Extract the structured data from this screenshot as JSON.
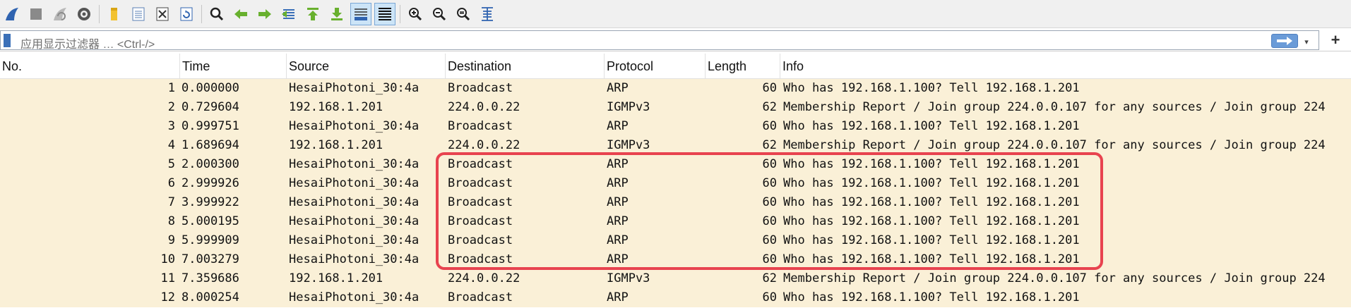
{
  "toolbar": {
    "buttons": [
      {
        "name": "start-capture-icon"
      },
      {
        "name": "stop-capture-icon"
      },
      {
        "name": "restart-capture-icon"
      },
      {
        "name": "capture-options-icon"
      },
      {
        "name": "open-file-icon"
      },
      {
        "name": "save-file-icon"
      },
      {
        "name": "close-file-icon"
      },
      {
        "name": "reload-file-icon"
      },
      {
        "name": "find-packet-icon"
      },
      {
        "name": "go-back-icon"
      },
      {
        "name": "go-forward-icon"
      },
      {
        "name": "go-to-packet-icon"
      },
      {
        "name": "go-first-icon"
      },
      {
        "name": "go-last-icon"
      },
      {
        "name": "autoscroll-icon"
      },
      {
        "name": "colorize-icon"
      },
      {
        "name": "zoom-in-icon"
      },
      {
        "name": "zoom-out-icon"
      },
      {
        "name": "zoom-normal-icon"
      },
      {
        "name": "resize-columns-icon"
      }
    ]
  },
  "filter": {
    "placeholder": "应用显示过滤器 … <Ctrl-/>",
    "plus_label": "+",
    "dropdown_glyph": "▾"
  },
  "columns": {
    "no": "No.",
    "time": "Time",
    "source": "Source",
    "destination": "Destination",
    "protocol": "Protocol",
    "length": "Length",
    "info": "Info"
  },
  "packets": [
    {
      "no": "1",
      "time": "0.000000",
      "source": "HesaiPhotoni_30:4a",
      "destination": "Broadcast",
      "protocol": "ARP",
      "length": "60",
      "info": "Who has 192.168.1.100? Tell 192.168.1.201"
    },
    {
      "no": "2",
      "time": "0.729604",
      "source": "192.168.1.201",
      "destination": "224.0.0.22",
      "protocol": "IGMPv3",
      "length": "62",
      "info": "Membership Report / Join group 224.0.0.107 for any sources / Join group 224"
    },
    {
      "no": "3",
      "time": "0.999751",
      "source": "HesaiPhotoni_30:4a",
      "destination": "Broadcast",
      "protocol": "ARP",
      "length": "60",
      "info": "Who has 192.168.1.100? Tell 192.168.1.201"
    },
    {
      "no": "4",
      "time": "1.689694",
      "source": "192.168.1.201",
      "destination": "224.0.0.22",
      "protocol": "IGMPv3",
      "length": "62",
      "info": "Membership Report / Join group 224.0.0.107 for any sources / Join group 224"
    },
    {
      "no": "5",
      "time": "2.000300",
      "source": "HesaiPhotoni_30:4a",
      "destination": "Broadcast",
      "protocol": "ARP",
      "length": "60",
      "info": "Who has 192.168.1.100? Tell 192.168.1.201"
    },
    {
      "no": "6",
      "time": "2.999926",
      "source": "HesaiPhotoni_30:4a",
      "destination": "Broadcast",
      "protocol": "ARP",
      "length": "60",
      "info": "Who has 192.168.1.100? Tell 192.168.1.201"
    },
    {
      "no": "7",
      "time": "3.999922",
      "source": "HesaiPhotoni_30:4a",
      "destination": "Broadcast",
      "protocol": "ARP",
      "length": "60",
      "info": "Who has 192.168.1.100? Tell 192.168.1.201"
    },
    {
      "no": "8",
      "time": "5.000195",
      "source": "HesaiPhotoni_30:4a",
      "destination": "Broadcast",
      "protocol": "ARP",
      "length": "60",
      "info": "Who has 192.168.1.100? Tell 192.168.1.201"
    },
    {
      "no": "9",
      "time": "5.999909",
      "source": "HesaiPhotoni_30:4a",
      "destination": "Broadcast",
      "protocol": "ARP",
      "length": "60",
      "info": "Who has 192.168.1.100? Tell 192.168.1.201"
    },
    {
      "no": "10",
      "time": "7.003279",
      "source": "HesaiPhotoni_30:4a",
      "destination": "Broadcast",
      "protocol": "ARP",
      "length": "60",
      "info": "Who has 192.168.1.100? Tell 192.168.1.201"
    },
    {
      "no": "11",
      "time": "7.359686",
      "source": "192.168.1.201",
      "destination": "224.0.0.22",
      "protocol": "IGMPv3",
      "length": "62",
      "info": "Membership Report / Join group 224.0.0.107 for any sources / Join group 224"
    },
    {
      "no": "12",
      "time": "8.000254",
      "source": "HesaiPhotoni_30:4a",
      "destination": "Broadcast",
      "protocol": "ARP",
      "length": "60",
      "info": "Who has 192.168.1.100? Tell 192.168.1.201"
    }
  ],
  "colors": {
    "row_bg": "#faf0d7",
    "highlight_border": "#e8434f",
    "accent_blue": "#3b70b8"
  }
}
